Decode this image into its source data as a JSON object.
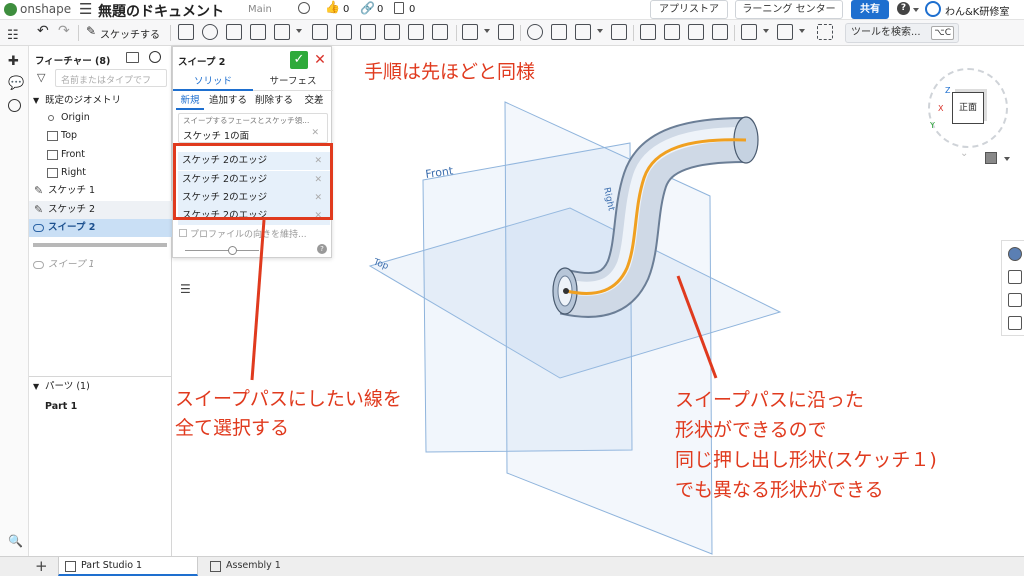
{
  "header": {
    "logo_text": "onshape",
    "doc_title": "無題のドキュメント",
    "branch": "Main",
    "likes": "0",
    "links": "0",
    "copies": "0",
    "app_store": "アプリストア",
    "learning_center": "ラーニング センター",
    "share": "共有",
    "user": "わん&K研修室"
  },
  "toolbar": {
    "sketch_label": "スケッチする",
    "tool_search": "ツールを検索...",
    "shortcut": "⌥C"
  },
  "feature_list": {
    "title": "フィーチャー (8)",
    "filter_placeholder": "名前またはタイプでフ",
    "default_geometry": "既定のジオメトリ",
    "origin": "Origin",
    "top": "Top",
    "front": "Front",
    "right": "Right",
    "sketch1": "スケッチ 1",
    "sketch2": "スケッチ 2",
    "sweep2": "スイープ 2",
    "sweep1": "スイープ 1",
    "parts_header": "パーツ (1)",
    "part1": "Part 1"
  },
  "sweep_dialog": {
    "title": "スイープ 2",
    "tab_solid": "ソリッド",
    "tab_surface": "サーフェス",
    "op_new": "新規",
    "op_add": "追加する",
    "op_remove": "削除する",
    "op_intersect": "交差",
    "face_hint": "スイープするフェースとスケッチ領...",
    "face_value": "スケッチ 1の面",
    "edges": [
      "スケッチ 2のエッジ",
      "スケッチ 2のエッジ",
      "スケッチ 2のエッジ",
      "スケッチ 2のエッジ"
    ],
    "keep_profile": "プロファイルの向きを維持..."
  },
  "viewport": {
    "front_label": "Front",
    "top_label": "Top",
    "right_label": "Right",
    "viewcube_face": "正面",
    "axis_x": "X",
    "axis_y": "Y",
    "axis_z": "Z"
  },
  "annotations": {
    "note_top": "手順は先ほどと同様",
    "note_left": [
      "スイープパスにしたい線を",
      "全て選択する"
    ],
    "note_right": [
      "スイープパスに沿った",
      "形状ができるので",
      "同じ押し出し形状(スケッチ１)",
      "でも異なる形状ができる"
    ]
  },
  "tabs": {
    "tab1": "Part Studio 1",
    "tab2": "Assembly 1"
  },
  "colors": {
    "accent_blue": "#1e6fcf",
    "confirm_green": "#2eaa3a",
    "annotation_red": "#e03a1e",
    "path_orange": "#f0a020"
  }
}
